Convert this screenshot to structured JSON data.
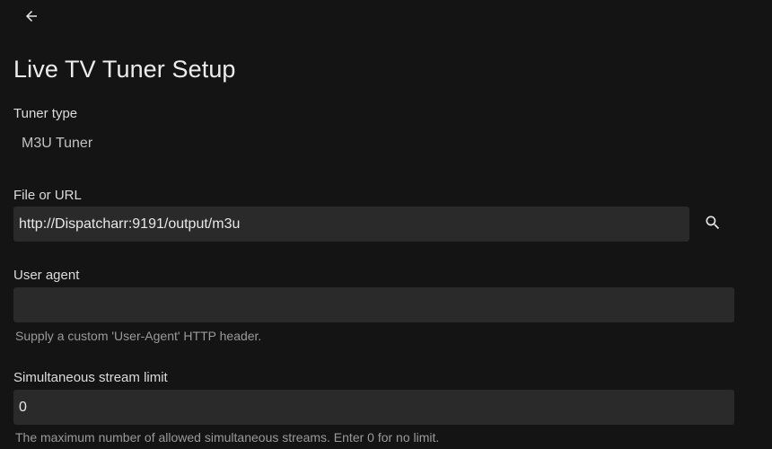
{
  "header": {
    "title": "Live TV Tuner Setup"
  },
  "tuner_type": {
    "label": "Tuner type",
    "value": "M3U Tuner"
  },
  "file_or_url": {
    "label": "File or URL",
    "value": "http://Dispatcharr:9191/output/m3u"
  },
  "user_agent": {
    "label": "User agent",
    "value": "",
    "help": "Supply a custom 'User-Agent' HTTP header."
  },
  "stream_limit": {
    "label": "Simultaneous stream limit",
    "value": "0",
    "help": "The maximum number of allowed simultaneous streams. Enter 0 for no limit."
  },
  "icons": {
    "back": "arrow-left-icon",
    "search": "search-icon"
  }
}
